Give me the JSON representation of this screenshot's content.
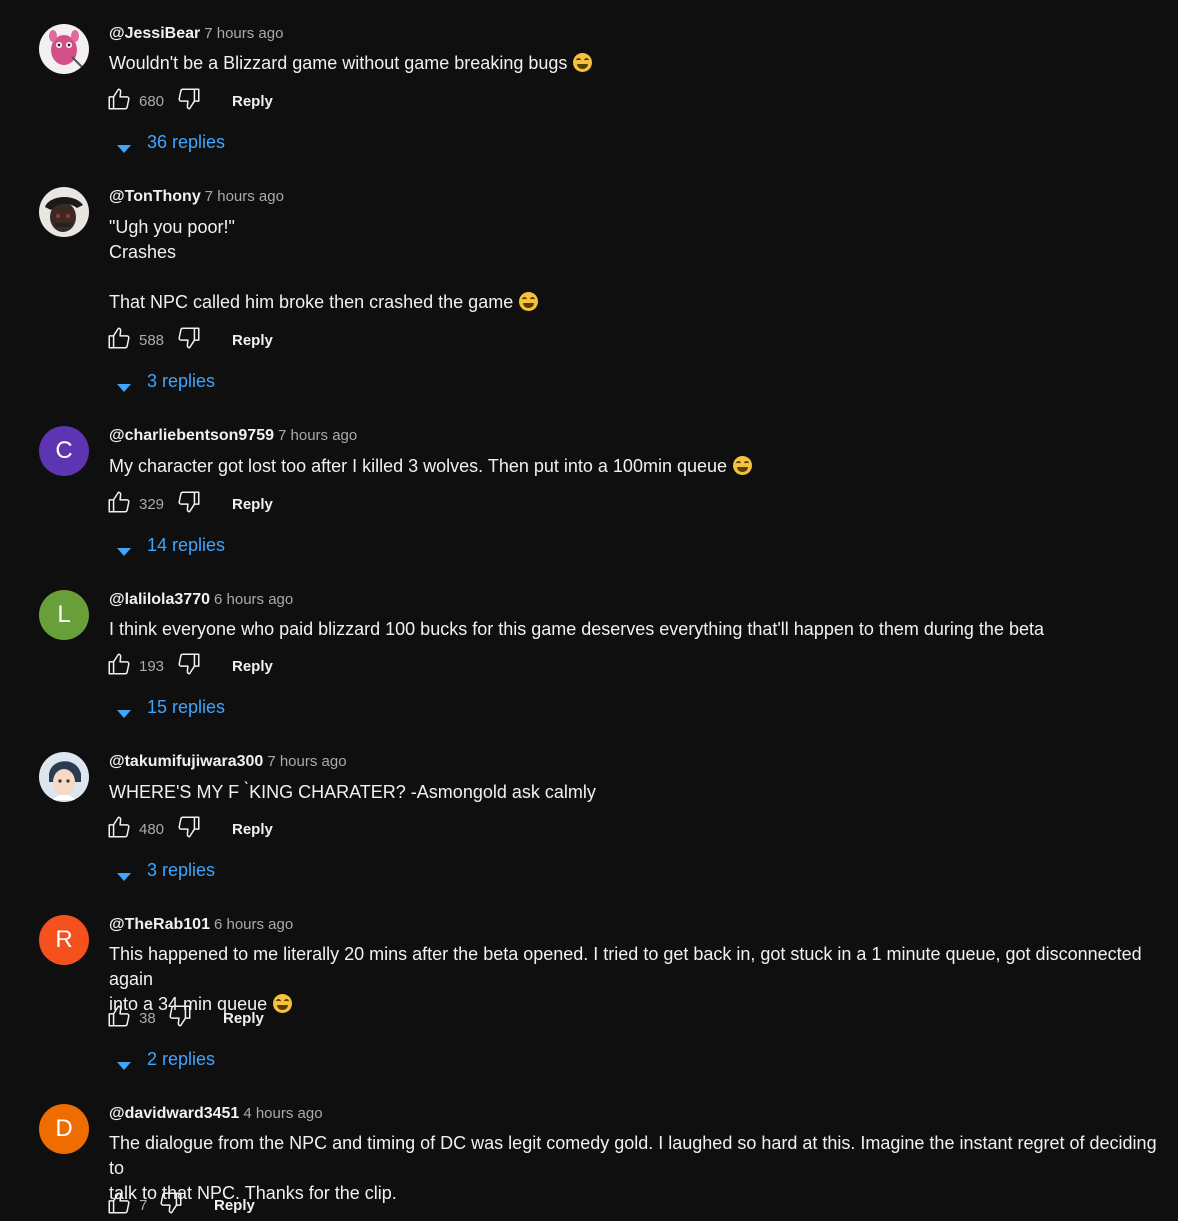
{
  "actions": {
    "reply_label": "Reply"
  },
  "colors": {
    "background": "#0f0f0f",
    "link": "#3ea6ff",
    "secondary_text": "#aaaaaa"
  },
  "comments": [
    {
      "author": "@JessiBear",
      "time": "7 hours ago",
      "avatar": {
        "type": "image",
        "icon": "pink-character-avatar"
      },
      "lines": [
        "Wouldn't be a Blizzard game without game breaking bugs"
      ],
      "emoji": "laughing-emoji",
      "likes": "680",
      "replies": "36 replies"
    },
    {
      "author": "@TonThony",
      "time": "7 hours ago",
      "avatar": {
        "type": "image",
        "icon": "person-hat-avatar"
      },
      "lines": [
        "\"Ugh you poor!\"",
        "Crashes",
        "",
        "That NPC called him broke then crashed the game"
      ],
      "emoji": "rolling-laughing-emoji",
      "likes": "588",
      "replies": "3 replies"
    },
    {
      "author": "@charliebentson9759",
      "time": "7 hours ago",
      "avatar": {
        "type": "letter",
        "letter": "C",
        "color": "#5e35b1"
      },
      "lines": [
        "My character got lost too after I killed 3 wolves. Then put into a 100min queue"
      ],
      "emoji": "laughing-emoji",
      "likes": "329",
      "replies": "14 replies"
    },
    {
      "author": "@lalilola3770",
      "time": "6 hours ago",
      "avatar": {
        "type": "letter",
        "letter": "L",
        "color": "#689f38"
      },
      "lines": [
        "I think everyone who paid blizzard 100 bucks for this game deserves everything that'll happen to them during the beta"
      ],
      "emoji": "",
      "likes": "193",
      "replies": "15 replies"
    },
    {
      "author": "@takumifujiwara300",
      "time": "7 hours ago",
      "avatar": {
        "type": "image",
        "icon": "anime-character-avatar"
      },
      "lines": [
        "WHERE'S MY F  ̀KING CHARATER? -Asmongold ask calmly"
      ],
      "emoji": "",
      "likes": "480",
      "replies": "3 replies"
    },
    {
      "author": "@TheRab101",
      "time": "6 hours ago",
      "avatar": {
        "type": "letter",
        "letter": "R",
        "color": "#f4511e"
      },
      "lines": [
        "This happened to me literally 20 mins after the beta opened. I tried to get back in, got stuck in a 1 minute queue, got disconnected again",
        "into a 34 min queue"
      ],
      "emoji": "laughing-emoji",
      "likes": "38",
      "replies": "2 replies"
    },
    {
      "author": "@davidward3451",
      "time": "4 hours ago",
      "avatar": {
        "type": "letter",
        "letter": "D",
        "color": "#ef6c00"
      },
      "lines": [
        "The dialogue from the NPC and timing of DC was legit comedy gold. I laughed so hard at this. Imagine the instant regret of deciding to",
        "talk to that NPC. Thanks for the clip."
      ],
      "emoji": "",
      "likes": "7",
      "replies": ""
    }
  ]
}
